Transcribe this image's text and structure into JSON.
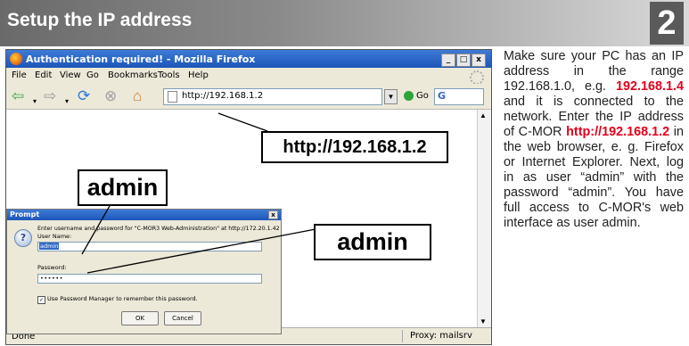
{
  "header": {
    "title": "Setup the IP address",
    "step_number": "2"
  },
  "browser": {
    "window_title": "Authentication required! - Mozilla Firefox",
    "window_buttons": [
      "_",
      "□",
      "x"
    ],
    "menu": [
      "File",
      "Edit",
      "View",
      "Go",
      "Bookmarks",
      "Tools",
      "Help"
    ],
    "url": "http://192.168.1.2",
    "go_label": "Go",
    "search_glyph": "G",
    "status_left": "Done",
    "status_right": "Proxy: mailsrv"
  },
  "prompt": {
    "title": "Prompt",
    "message": "Enter username and password for \"C-MOR3 Web-Administration\" at http://172.20.1.42",
    "username_label": "User Name:",
    "username_value": "admin",
    "password_label": "Password:",
    "password_value": "••••••",
    "remember_label": "Use Password Manager to remember this password.",
    "remember_checked": true,
    "ok_label": "OK",
    "cancel_label": "Cancel"
  },
  "callouts": {
    "url": "http://192.168.1.2",
    "username": "admin",
    "password": "admin"
  },
  "description": {
    "line1": "Make sure your PC has an IP address in the range 192.168.1.0, e.g.",
    "ip_example": "192.168.1.4",
    "line2": " and it is connected to the network. Enter the IP address of C-MOR ",
    "ip_cmor": "http://192.168.1.2",
    "line3": " in the web browser, e. g. Firefox or Internet Explorer. Next, log in as user “admin” with the password “admin”. You have full access to C-MOR's web",
    "line4": "interface as user admin."
  },
  "colors": {
    "highlight": "#e3001b",
    "header_dark": "#6a6a6a",
    "titlebar_blue": "#1d55b8"
  }
}
